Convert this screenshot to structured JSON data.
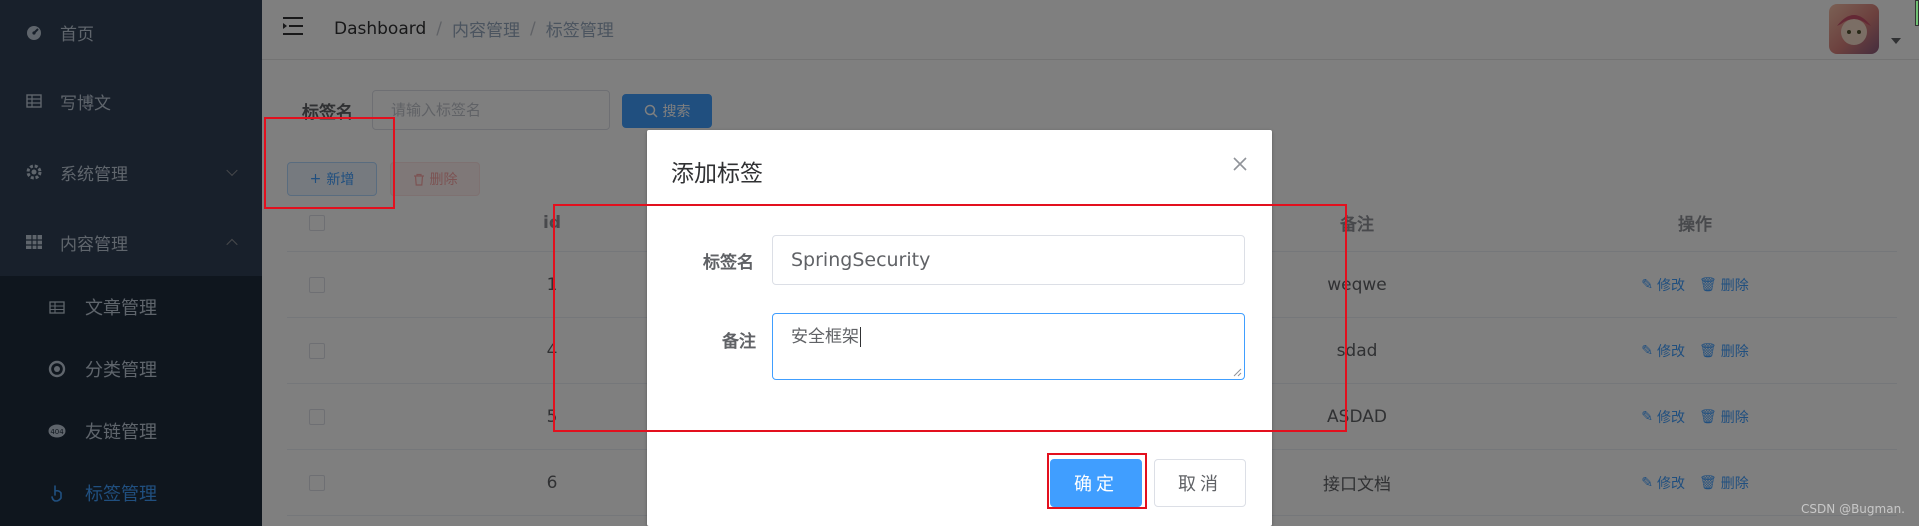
{
  "sidebar": {
    "items": [
      {
        "label": "首页",
        "icon": "dashboard-icon"
      },
      {
        "label": "写博文",
        "icon": "table-icon"
      },
      {
        "label": "系统管理",
        "icon": "gear-icon"
      },
      {
        "label": "内容管理",
        "icon": "grid-icon"
      }
    ],
    "subitems": [
      {
        "label": "文章管理",
        "icon": "table-icon"
      },
      {
        "label": "分类管理",
        "icon": "category-icon"
      },
      {
        "label": "友链管理",
        "icon": "link-icon"
      },
      {
        "label": "标签管理",
        "icon": "hand-icon",
        "active": true
      }
    ]
  },
  "header": {
    "breadcrumb": [
      "Dashboard",
      "内容管理",
      "标签管理"
    ]
  },
  "search": {
    "label": "标签名",
    "placeholder": "请输入标签名",
    "button": "搜索"
  },
  "toolbar": {
    "add": "新增",
    "delete": "删除"
  },
  "table": {
    "columns": [
      "id",
      "备注",
      "操作"
    ],
    "rows": [
      {
        "id": "1",
        "remark": "weqwe"
      },
      {
        "id": "4",
        "remark": "sdad"
      },
      {
        "id": "5",
        "remark": "ASDAD"
      },
      {
        "id": "6",
        "remark": "接口文档"
      }
    ],
    "edit": "修改",
    "delete": "删除"
  },
  "dialog": {
    "title": "添加标签",
    "name_label": "标签名",
    "name_value": "SpringSecurity",
    "remark_label": "备注",
    "remark_value": "安全框架",
    "ok": "确定",
    "cancel": "取消"
  },
  "watermark": "CSDN @Bugman.",
  "colors": {
    "sidebar_bg": "#304156",
    "primary": "#409eff",
    "annotation": "#e3101e"
  }
}
